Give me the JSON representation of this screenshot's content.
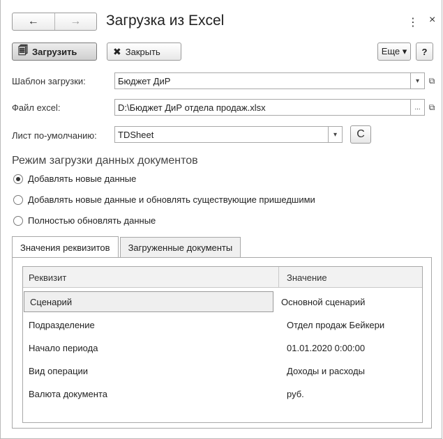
{
  "window": {
    "title": "Загрузка из Excel",
    "back_icon": "←",
    "forward_icon": "→",
    "menu_icon": "⋮",
    "close_icon": "×"
  },
  "toolbar": {
    "load_label": "Загрузить",
    "load_icon": "🗐",
    "close_label": "Закрыть",
    "close_icon": "✖",
    "more_label": "Еще ▾",
    "help_label": "?"
  },
  "form": {
    "template_label": "Шаблон загрузки:",
    "template_value": "Бюджет ДиР",
    "file_label": "Файл excel:",
    "file_value": "D:\\Бюджет ДиР отдела продаж.xlsx",
    "sheet_label": "Лист по-умолчанию:",
    "sheet_value": "TDSheet",
    "dropdown_glyph": "▾",
    "open_glyph": "⧉",
    "browse_glyph": "...",
    "refresh_glyph": "C"
  },
  "mode": {
    "title": "Режим загрузки данных документов",
    "options": [
      {
        "label": "Добавлять новые данные",
        "checked": true
      },
      {
        "label": "Добавлять новые данные и обновлять существующие пришедшими",
        "checked": false
      },
      {
        "label": "Полностью обновлять данные",
        "checked": false
      }
    ]
  },
  "tabs": [
    {
      "label": "Значения реквизитов",
      "active": true
    },
    {
      "label": "Загруженные документы",
      "active": false
    }
  ],
  "table": {
    "headers": [
      "Реквизит",
      "Значение"
    ],
    "rows": [
      {
        "attr": "Сценарий",
        "value": "Основной сценарий",
        "selected": true
      },
      {
        "attr": "Подразделение",
        "value": "Отдел продаж Бейкери",
        "selected": false
      },
      {
        "attr": "Начало периода",
        "value": "01.01.2020 0:00:00",
        "selected": false
      },
      {
        "attr": "Вид операции",
        "value": "Доходы и расходы",
        "selected": false
      },
      {
        "attr": "Валюта документа",
        "value": "руб.",
        "selected": false
      }
    ]
  }
}
